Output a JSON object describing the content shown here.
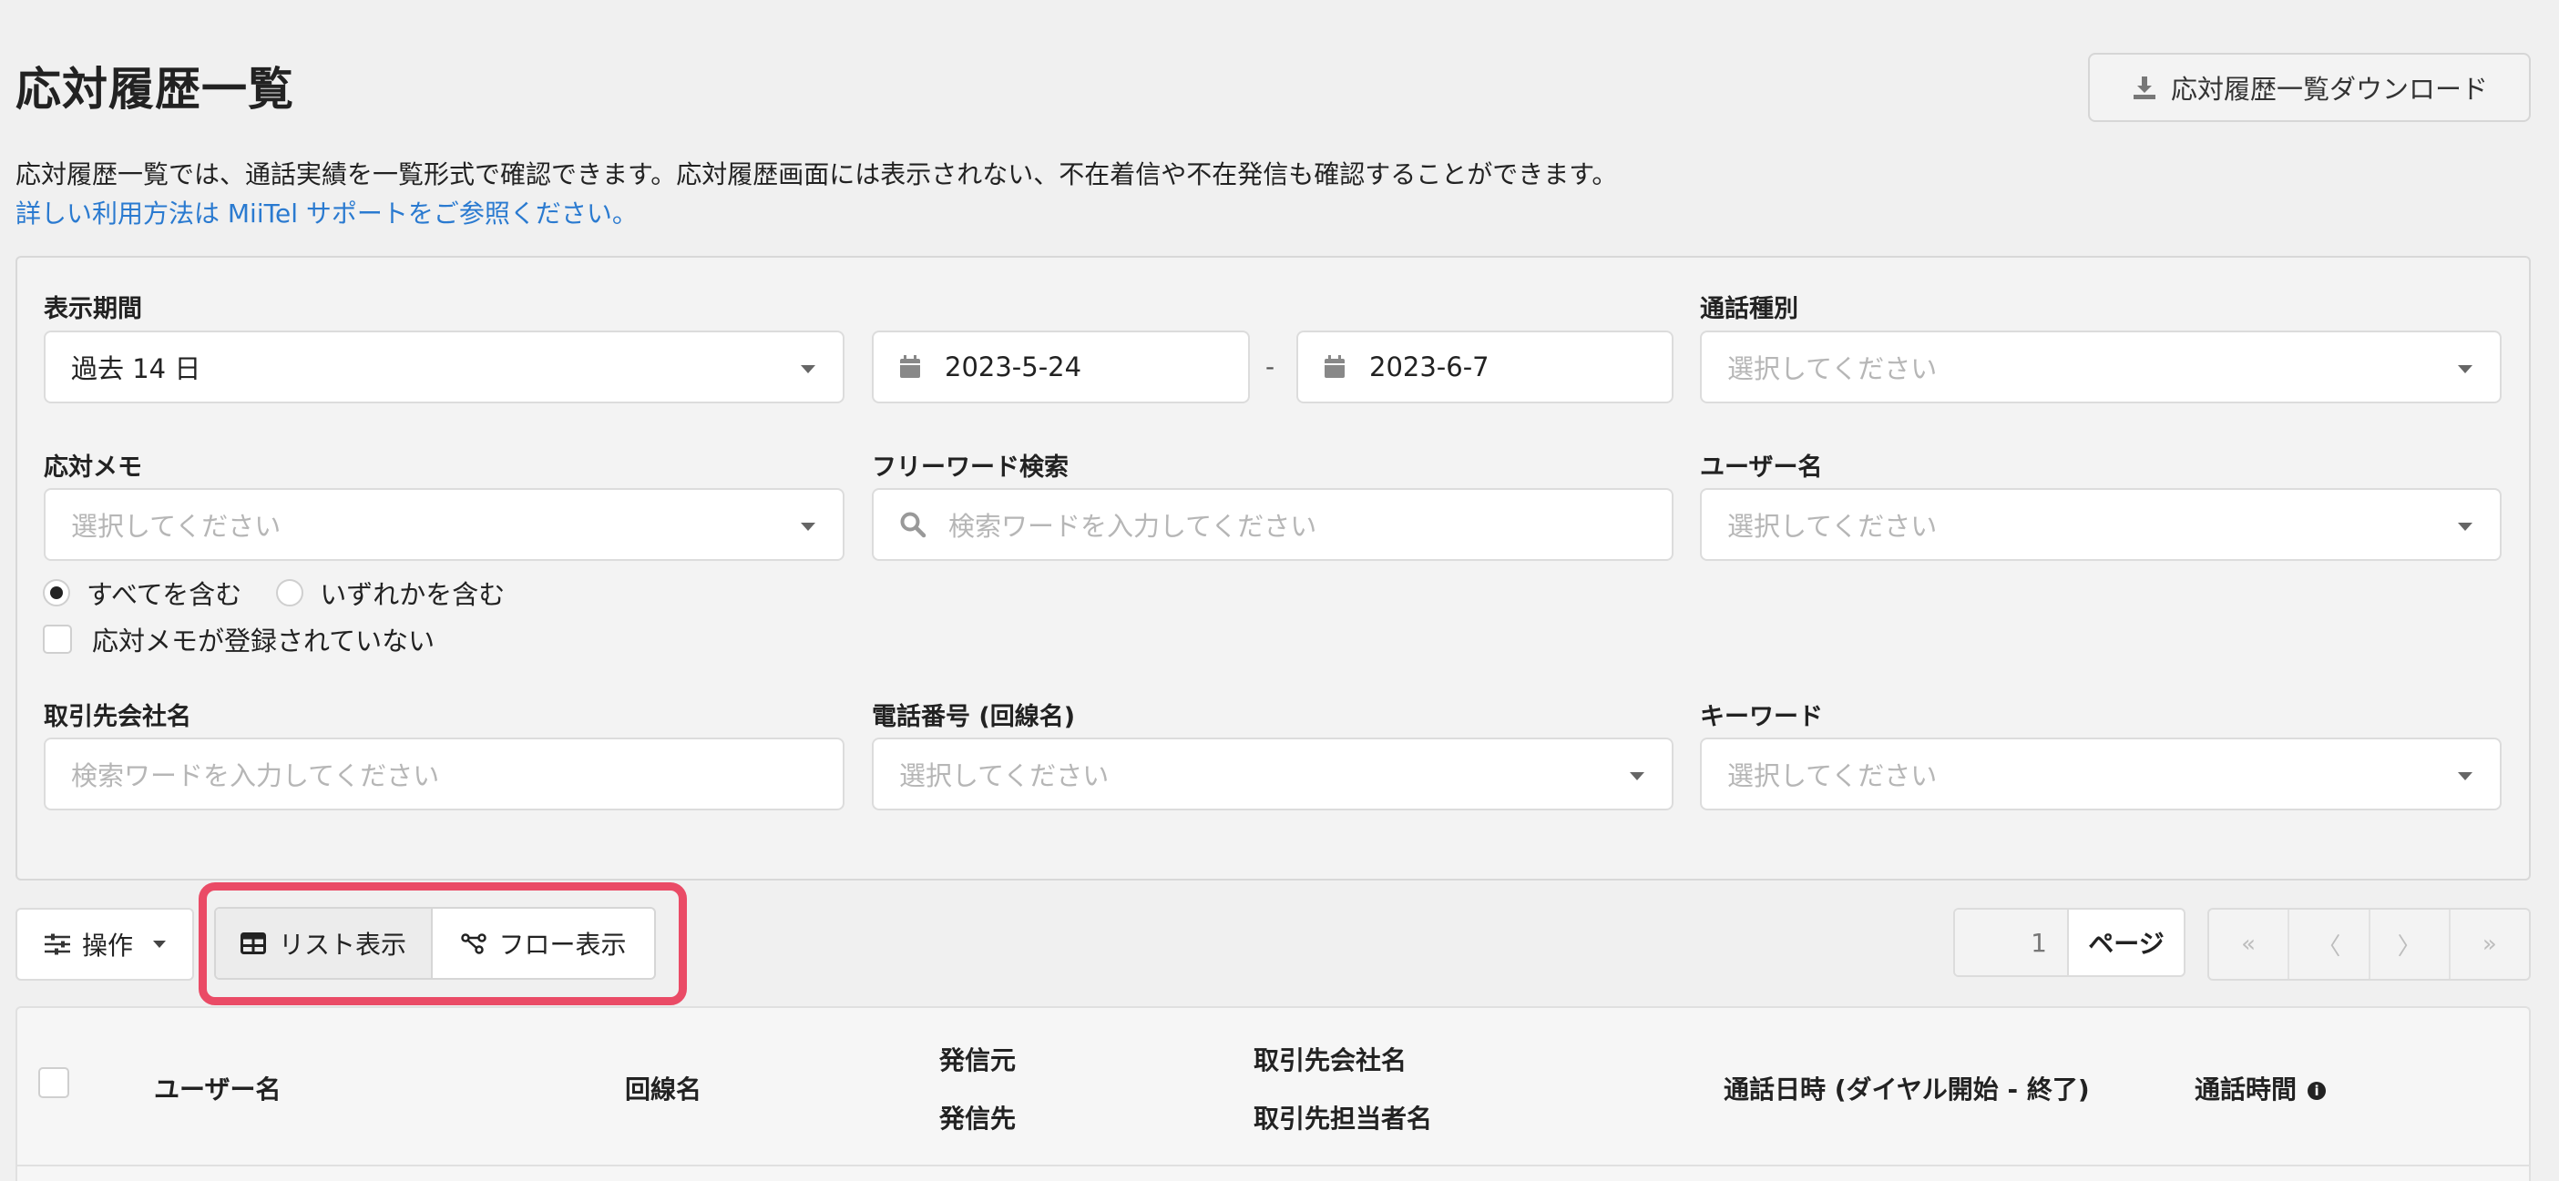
{
  "header": {
    "title": "応対履歴一覧",
    "download_label": "応対履歴一覧ダウンロード",
    "description": "応対履歴一覧では、通話実績を一覧形式で確認できます。応対履歴画面には表示されない、不在着信や不在発信も確認することができます。",
    "help_link": "詳しい利用方法は MiiTel サポートをご参照ください。"
  },
  "filters": {
    "period": {
      "label": "表示期間",
      "value": "過去 14 日",
      "start_date": "2023-5-24",
      "separator": "-",
      "end_date": "2023-6-7"
    },
    "call_type": {
      "label": "通話種別",
      "placeholder": "選択してください"
    },
    "memo": {
      "label": "応対メモ",
      "placeholder": "選択してください"
    },
    "free_word": {
      "label": "フリーワード検索",
      "placeholder": "検索ワードを入力してください"
    },
    "user_name": {
      "label": "ユーザー名",
      "placeholder": "選択してください"
    },
    "memo_match": {
      "all_label": "すべてを含む",
      "any_label": "いずれかを含む",
      "selected": "all"
    },
    "memo_unregistered_label": "応対メモが登録されていない",
    "company": {
      "label": "取引先会社名",
      "placeholder": "検索ワードを入力してください"
    },
    "phone": {
      "label": "電話番号 (回線名)",
      "placeholder": "選択してください"
    },
    "keyword": {
      "label": "キーワード",
      "placeholder": "選択してください"
    }
  },
  "toolbar": {
    "operations_label": "操作",
    "list_view_label": "リスト表示",
    "flow_view_label": "フロー表示",
    "active_view": "list",
    "highlight_color": "#ea4b66"
  },
  "pagination": {
    "page_number": "1",
    "page_label": "ページ",
    "first": "«",
    "prev": "〈",
    "next": "〉",
    "last": "»"
  },
  "table": {
    "columns": {
      "user": "ユーザー名",
      "line": "回線名",
      "caller": "発信元",
      "callee": "発信先",
      "company": "取引先会社名",
      "contact": "取引先担当者名",
      "datetime": "通話日時 (ダイヤル開始 - 終了)",
      "duration": "通話時間"
    }
  },
  "colors": {
    "link": "#2a7ad0",
    "background": "#f0f0f0"
  }
}
